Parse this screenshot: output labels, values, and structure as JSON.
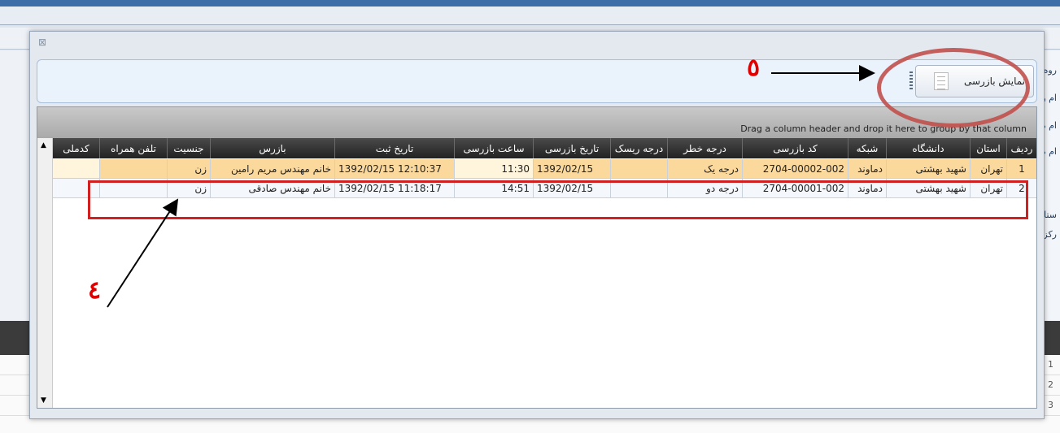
{
  "dialog": {
    "close_glyph": "⊠",
    "toolbar": {
      "show_inspection_label": "نمایش بازرسی"
    },
    "group_hint": "Drag a column header and drop it here to group by that column",
    "columns": [
      "ردیف",
      "استان",
      "دانشگاه",
      "شبکه",
      "کد بازرسی",
      "درجه خطر",
      "درجه ریسک",
      "تاریخ بازرسی",
      "ساعت بازرسی",
      "تاریخ ثبت",
      "بازرس",
      "جنسیت",
      "تلفن همراه",
      "کدملی"
    ],
    "rows": [
      {
        "radif": "1",
        "ostan": "تهران",
        "daneshgah": "شهید بهشتی",
        "shabake": "دماوند",
        "code": "2704-00002-002",
        "khatar": "درجه یک",
        "risk": "",
        "tarikh": "1392/02/15",
        "saat": "11:30",
        "sabt": "1392/02/15 12:10:37",
        "bazres": "خانم مهندس مریم رامین",
        "jensiat": "زن",
        "tel": "",
        "melli": ""
      },
      {
        "radif": "2",
        "ostan": "تهران",
        "daneshgah": "شهید بهشتی",
        "shabake": "دماوند",
        "code": "2704-00001-002",
        "khatar": "درجه دو",
        "risk": "",
        "tarikh": "1392/02/15",
        "saat": "14:51",
        "sabt": "1392/02/15 11:18:17",
        "bazres": "خانم مهندس صادقی",
        "jensiat": "زن",
        "tel": "",
        "melli": ""
      }
    ]
  },
  "annotations": {
    "label_5": "٥",
    "label_4": "٤"
  },
  "background": {
    "side_labels": [
      "روه",
      "ام و",
      "ام ه",
      "ام ه",
      "ستان",
      "ركز"
    ],
    "bg_rows": [
      "1",
      "2",
      "3"
    ]
  },
  "colors": {
    "selected_row": "#fbd89c",
    "annotation_red": "#e00000",
    "header_dark": "#2b2b2b"
  }
}
